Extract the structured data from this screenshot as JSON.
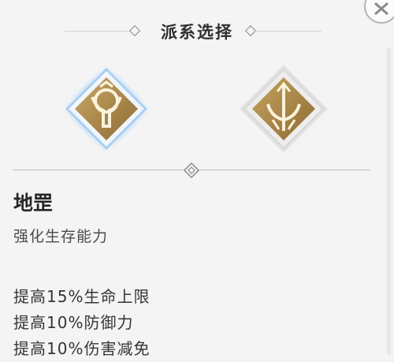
{
  "header": {
    "title": "派系选择"
  },
  "factions": [
    {
      "icon": "dizui-emblem-icon",
      "selected": true
    },
    {
      "icon": "trident-emblem-icon",
      "selected": false
    }
  ],
  "detail": {
    "name": "地罡",
    "subtitle": "强化生存能力",
    "effects": [
      "提高15%生命上限",
      "提高10%防御力",
      "提高10%伤害减免"
    ]
  },
  "colors": {
    "gold": "#b08d4f",
    "selected_glow": "#a9cff2",
    "background": "#f4f4f4"
  }
}
